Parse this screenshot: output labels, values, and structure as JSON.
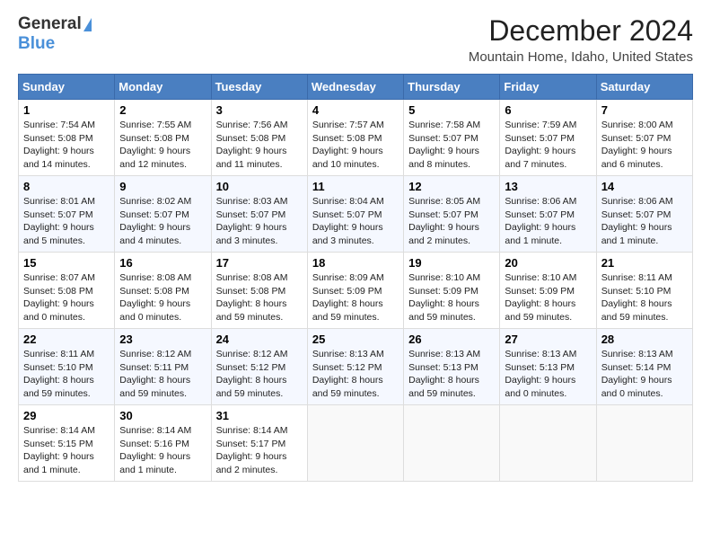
{
  "header": {
    "logo_general": "General",
    "logo_blue": "Blue",
    "month_title": "December 2024",
    "location": "Mountain Home, Idaho, United States"
  },
  "weekdays": [
    "Sunday",
    "Monday",
    "Tuesday",
    "Wednesday",
    "Thursday",
    "Friday",
    "Saturday"
  ],
  "weeks": [
    [
      {
        "day": "1",
        "sunrise": "Sunrise: 7:54 AM",
        "sunset": "Sunset: 5:08 PM",
        "daylight": "Daylight: 9 hours and 14 minutes."
      },
      {
        "day": "2",
        "sunrise": "Sunrise: 7:55 AM",
        "sunset": "Sunset: 5:08 PM",
        "daylight": "Daylight: 9 hours and 12 minutes."
      },
      {
        "day": "3",
        "sunrise": "Sunrise: 7:56 AM",
        "sunset": "Sunset: 5:08 PM",
        "daylight": "Daylight: 9 hours and 11 minutes."
      },
      {
        "day": "4",
        "sunrise": "Sunrise: 7:57 AM",
        "sunset": "Sunset: 5:08 PM",
        "daylight": "Daylight: 9 hours and 10 minutes."
      },
      {
        "day": "5",
        "sunrise": "Sunrise: 7:58 AM",
        "sunset": "Sunset: 5:07 PM",
        "daylight": "Daylight: 9 hours and 8 minutes."
      },
      {
        "day": "6",
        "sunrise": "Sunrise: 7:59 AM",
        "sunset": "Sunset: 5:07 PM",
        "daylight": "Daylight: 9 hours and 7 minutes."
      },
      {
        "day": "7",
        "sunrise": "Sunrise: 8:00 AM",
        "sunset": "Sunset: 5:07 PM",
        "daylight": "Daylight: 9 hours and 6 minutes."
      }
    ],
    [
      {
        "day": "8",
        "sunrise": "Sunrise: 8:01 AM",
        "sunset": "Sunset: 5:07 PM",
        "daylight": "Daylight: 9 hours and 5 minutes."
      },
      {
        "day": "9",
        "sunrise": "Sunrise: 8:02 AM",
        "sunset": "Sunset: 5:07 PM",
        "daylight": "Daylight: 9 hours and 4 minutes."
      },
      {
        "day": "10",
        "sunrise": "Sunrise: 8:03 AM",
        "sunset": "Sunset: 5:07 PM",
        "daylight": "Daylight: 9 hours and 3 minutes."
      },
      {
        "day": "11",
        "sunrise": "Sunrise: 8:04 AM",
        "sunset": "Sunset: 5:07 PM",
        "daylight": "Daylight: 9 hours and 3 minutes."
      },
      {
        "day": "12",
        "sunrise": "Sunrise: 8:05 AM",
        "sunset": "Sunset: 5:07 PM",
        "daylight": "Daylight: 9 hours and 2 minutes."
      },
      {
        "day": "13",
        "sunrise": "Sunrise: 8:06 AM",
        "sunset": "Sunset: 5:07 PM",
        "daylight": "Daylight: 9 hours and 1 minute."
      },
      {
        "day": "14",
        "sunrise": "Sunrise: 8:06 AM",
        "sunset": "Sunset: 5:07 PM",
        "daylight": "Daylight: 9 hours and 1 minute."
      }
    ],
    [
      {
        "day": "15",
        "sunrise": "Sunrise: 8:07 AM",
        "sunset": "Sunset: 5:08 PM",
        "daylight": "Daylight: 9 hours and 0 minutes."
      },
      {
        "day": "16",
        "sunrise": "Sunrise: 8:08 AM",
        "sunset": "Sunset: 5:08 PM",
        "daylight": "Daylight: 9 hours and 0 minutes."
      },
      {
        "day": "17",
        "sunrise": "Sunrise: 8:08 AM",
        "sunset": "Sunset: 5:08 PM",
        "daylight": "Daylight: 8 hours and 59 minutes."
      },
      {
        "day": "18",
        "sunrise": "Sunrise: 8:09 AM",
        "sunset": "Sunset: 5:09 PM",
        "daylight": "Daylight: 8 hours and 59 minutes."
      },
      {
        "day": "19",
        "sunrise": "Sunrise: 8:10 AM",
        "sunset": "Sunset: 5:09 PM",
        "daylight": "Daylight: 8 hours and 59 minutes."
      },
      {
        "day": "20",
        "sunrise": "Sunrise: 8:10 AM",
        "sunset": "Sunset: 5:09 PM",
        "daylight": "Daylight: 8 hours and 59 minutes."
      },
      {
        "day": "21",
        "sunrise": "Sunrise: 8:11 AM",
        "sunset": "Sunset: 5:10 PM",
        "daylight": "Daylight: 8 hours and 59 minutes."
      }
    ],
    [
      {
        "day": "22",
        "sunrise": "Sunrise: 8:11 AM",
        "sunset": "Sunset: 5:10 PM",
        "daylight": "Daylight: 8 hours and 59 minutes."
      },
      {
        "day": "23",
        "sunrise": "Sunrise: 8:12 AM",
        "sunset": "Sunset: 5:11 PM",
        "daylight": "Daylight: 8 hours and 59 minutes."
      },
      {
        "day": "24",
        "sunrise": "Sunrise: 8:12 AM",
        "sunset": "Sunset: 5:12 PM",
        "daylight": "Daylight: 8 hours and 59 minutes."
      },
      {
        "day": "25",
        "sunrise": "Sunrise: 8:13 AM",
        "sunset": "Sunset: 5:12 PM",
        "daylight": "Daylight: 8 hours and 59 minutes."
      },
      {
        "day": "26",
        "sunrise": "Sunrise: 8:13 AM",
        "sunset": "Sunset: 5:13 PM",
        "daylight": "Daylight: 8 hours and 59 minutes."
      },
      {
        "day": "27",
        "sunrise": "Sunrise: 8:13 AM",
        "sunset": "Sunset: 5:13 PM",
        "daylight": "Daylight: 9 hours and 0 minutes."
      },
      {
        "day": "28",
        "sunrise": "Sunrise: 8:13 AM",
        "sunset": "Sunset: 5:14 PM",
        "daylight": "Daylight: 9 hours and 0 minutes."
      }
    ],
    [
      {
        "day": "29",
        "sunrise": "Sunrise: 8:14 AM",
        "sunset": "Sunset: 5:15 PM",
        "daylight": "Daylight: 9 hours and 1 minute."
      },
      {
        "day": "30",
        "sunrise": "Sunrise: 8:14 AM",
        "sunset": "Sunset: 5:16 PM",
        "daylight": "Daylight: 9 hours and 1 minute."
      },
      {
        "day": "31",
        "sunrise": "Sunrise: 8:14 AM",
        "sunset": "Sunset: 5:17 PM",
        "daylight": "Daylight: 9 hours and 2 minutes."
      },
      null,
      null,
      null,
      null
    ]
  ]
}
